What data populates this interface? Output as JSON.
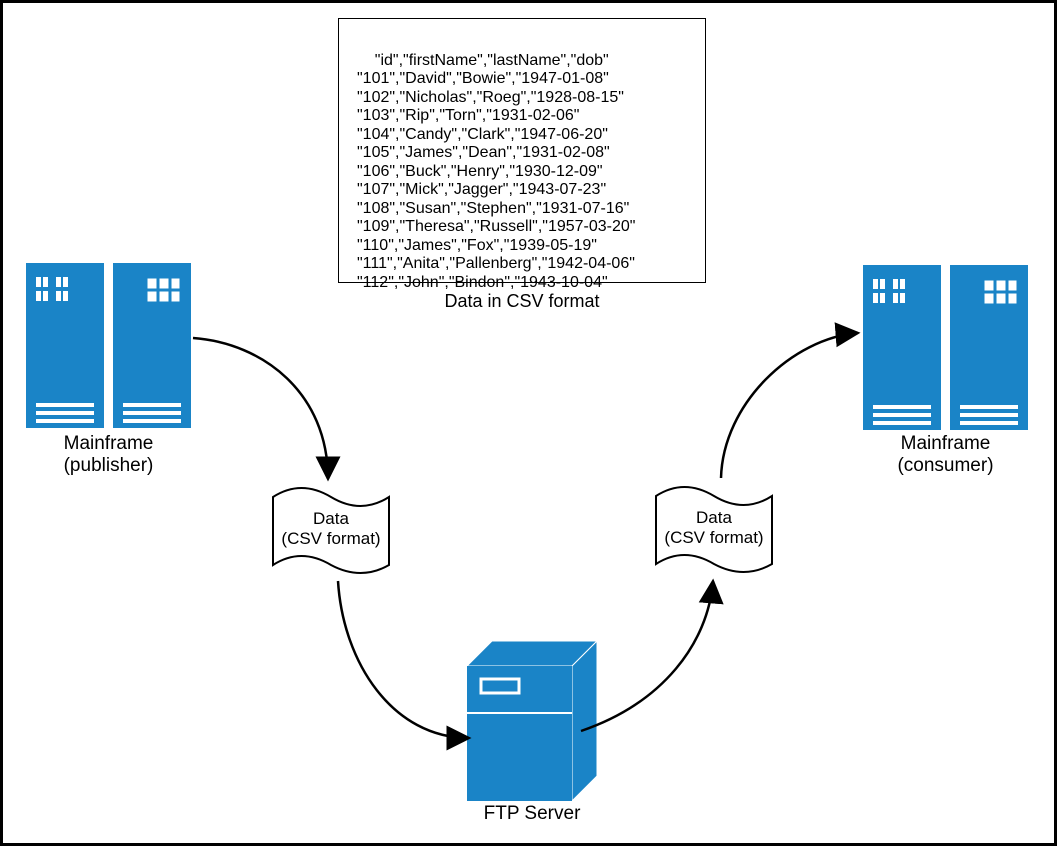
{
  "csv_box": {
    "lines": [
      "\"id\",\"firstName\",\"lastName\",\"dob\"",
      "\"101\",\"David\",\"Bowie\",\"1947-01-08\"",
      "\"102\",\"Nicholas\",\"Roeg\",\"1928-08-15\"",
      "\"103\",\"Rip\",\"Torn\",\"1931-02-06\"",
      "\"104\",\"Candy\",\"Clark\",\"1947-06-20\"",
      "\"105\",\"James\",\"Dean\",\"1931-02-08\"",
      "\"106\",\"Buck\",\"Henry\",\"1930-12-09\"",
      "\"107\",\"Mick\",\"Jagger\",\"1943-07-23\"",
      "\"108\",\"Susan\",\"Stephen\",\"1931-07-16\"",
      "\"109\",\"Theresa\",\"Russell\",\"1957-03-20\"",
      "\"110\",\"James\",\"Fox\",\"1939-05-19\"",
      "\"111\",\"Anita\",\"Pallenberg\",\"1942-04-06\"",
      "\"112\",\"John\",\"Bindon\",\"1943-10-04\""
    ],
    "caption": "Data in CSV format"
  },
  "publisher": {
    "line1": "Mainframe",
    "line2": "(publisher)"
  },
  "consumer": {
    "line1": "Mainframe",
    "line2": "(consumer)"
  },
  "doc_left": {
    "line1": "Data",
    "line2": "(CSV format)"
  },
  "doc_right": {
    "line1": "Data",
    "line2": "(CSV format)"
  },
  "ftp": {
    "label": "FTP Server"
  },
  "colors": {
    "blue": "#1A84C7"
  }
}
